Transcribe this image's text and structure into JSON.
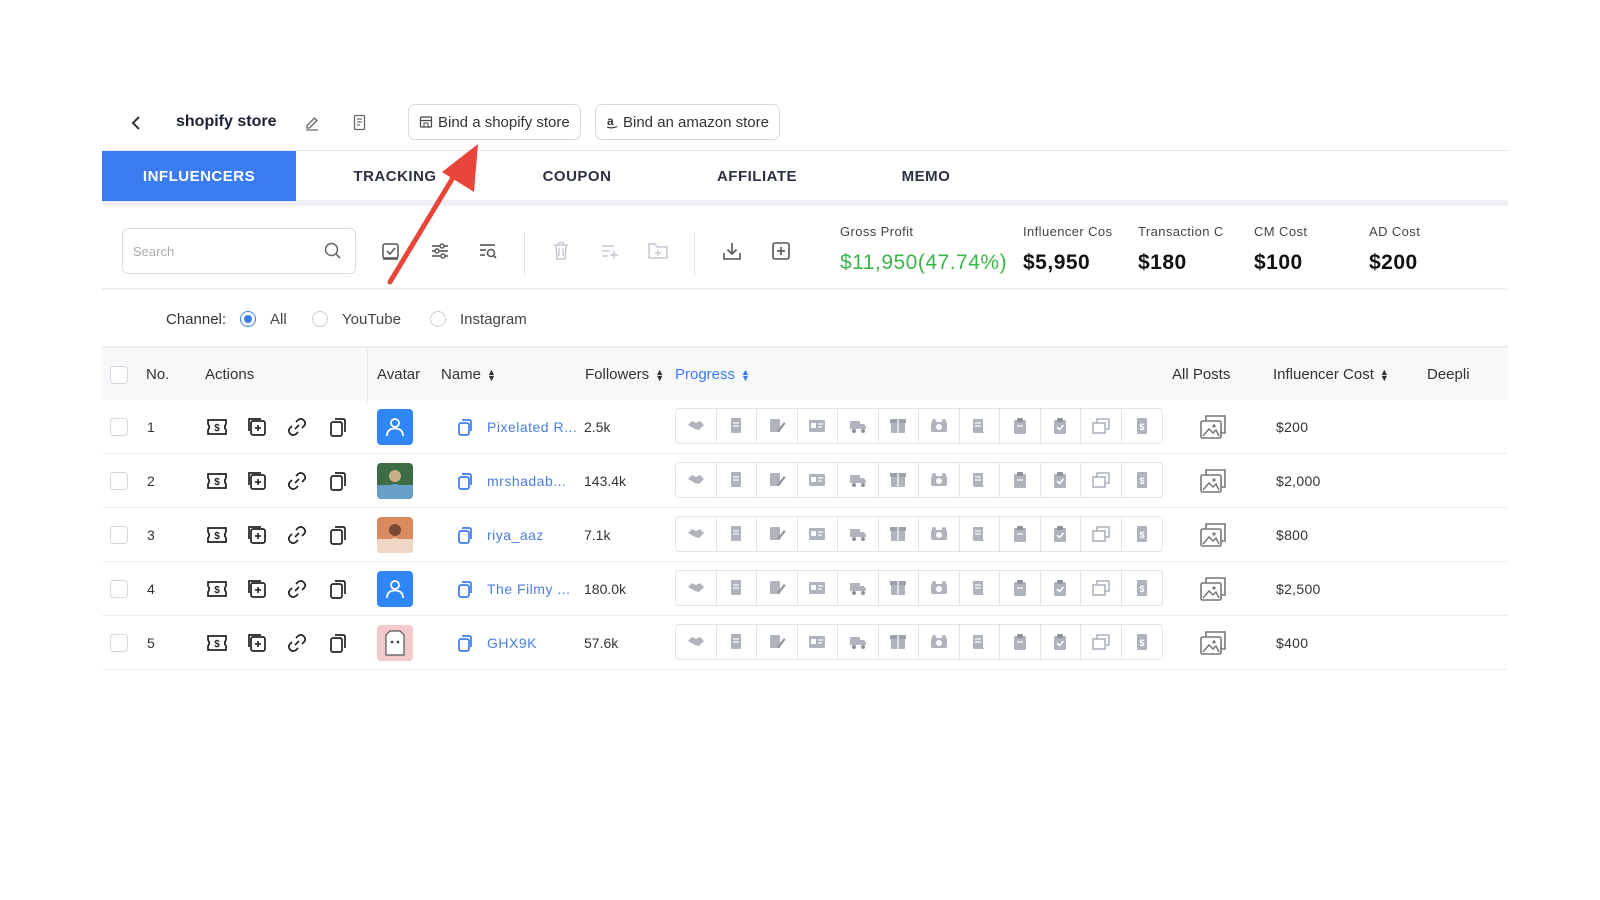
{
  "header": {
    "store_title": "shopify store",
    "bind_shopify_label": "Bind a shopify store",
    "bind_amazon_label": "Bind an amazon store"
  },
  "tabs": [
    {
      "label": "INFLUENCERS",
      "active": true
    },
    {
      "label": "TRACKING",
      "active": false
    },
    {
      "label": "COUPON",
      "active": false
    },
    {
      "label": "AFFILIATE",
      "active": false
    },
    {
      "label": "MEMO",
      "active": false
    }
  ],
  "toolbar": {
    "search_placeholder": "Search"
  },
  "stats": [
    {
      "label": "Gross Profit",
      "value": "$11,950(47.74%)"
    },
    {
      "label": "Influencer Cos",
      "value": "$5,950"
    },
    {
      "label": "Transaction C",
      "value": "$180"
    },
    {
      "label": "CM Cost",
      "value": "$100"
    },
    {
      "label": "AD Cost",
      "value": "$200"
    }
  ],
  "channel": {
    "label": "Channel:",
    "options": [
      "All",
      "YouTube",
      "Instagram"
    ],
    "selected": "All"
  },
  "table": {
    "columns": {
      "no": "No.",
      "actions": "Actions",
      "avatar": "Avatar",
      "name": "Name",
      "followers": "Followers",
      "progress": "Progress",
      "all_posts": "All Posts",
      "influencer_cost": "Influencer Cost",
      "deeplink": "Deepli"
    },
    "rows": [
      {
        "no": "1",
        "name": "Pixelated R...",
        "followers": "2.5k",
        "cost": "$200",
        "avatar": "default-user"
      },
      {
        "no": "2",
        "name": "mrshadab...",
        "followers": "143.4k",
        "cost": "$2,000",
        "avatar": "photo"
      },
      {
        "no": "3",
        "name": "riya_aaz",
        "followers": "7.1k",
        "cost": "$800",
        "avatar": "photo"
      },
      {
        "no": "4",
        "name": "The Filmy ...",
        "followers": "180.0k",
        "cost": "$2,500",
        "avatar": "default-user"
      },
      {
        "no": "5",
        "name": "GHX9K",
        "followers": "57.6k",
        "cost": "$400",
        "avatar": "cartoon"
      }
    ]
  },
  "colors": {
    "accent": "#3b7cf0",
    "profit_green": "#3cb54a",
    "annotation_red": "#e8463a"
  }
}
